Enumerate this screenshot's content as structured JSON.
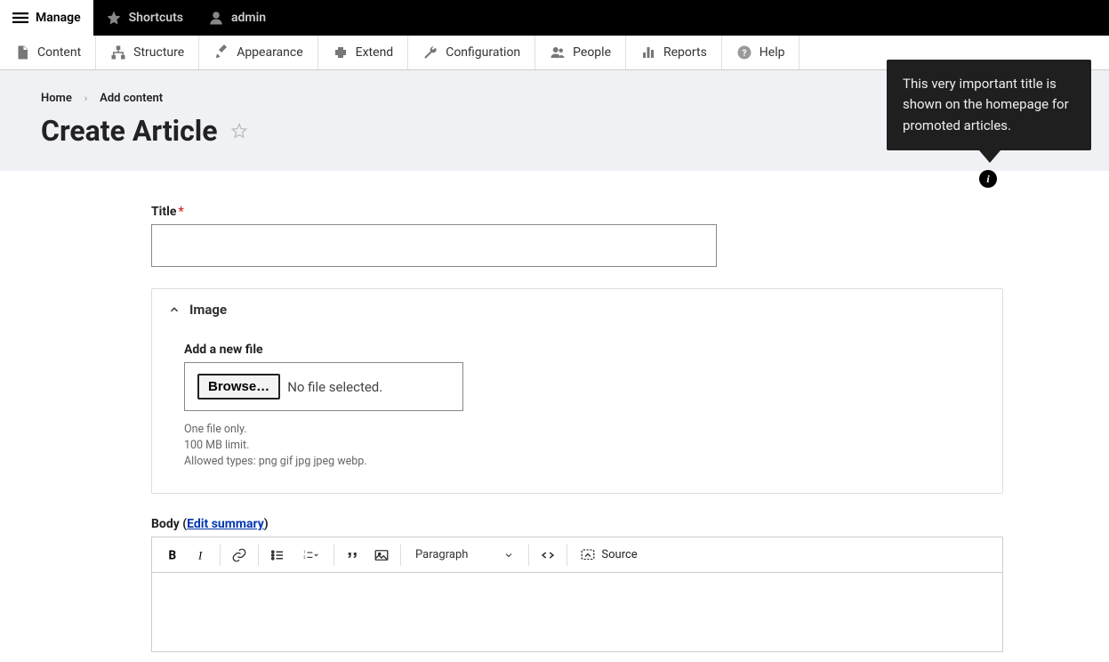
{
  "topbar": {
    "manage": "Manage",
    "shortcuts": "Shortcuts",
    "user": "admin"
  },
  "toolbar": {
    "items": [
      "Content",
      "Structure",
      "Appearance",
      "Extend",
      "Configuration",
      "People",
      "Reports",
      "Help"
    ]
  },
  "breadcrumb": {
    "home": "Home",
    "add_content": "Add content"
  },
  "page_title": "Create Article",
  "tooltip": "This very important title is shown on the homepage for promoted articles.",
  "title_field": {
    "label": "Title",
    "value": ""
  },
  "image_section": {
    "heading": "Image",
    "add_label": "Add a new file",
    "browse": "Browse…",
    "no_file": "No file selected.",
    "hint1": "One file only.",
    "hint2": "100 MB limit.",
    "hint3": "Allowed types: png gif jpg jpeg webp."
  },
  "body_field": {
    "label": "Body",
    "edit_summary": "Edit summary",
    "paragraph": "Paragraph",
    "source": "Source"
  }
}
